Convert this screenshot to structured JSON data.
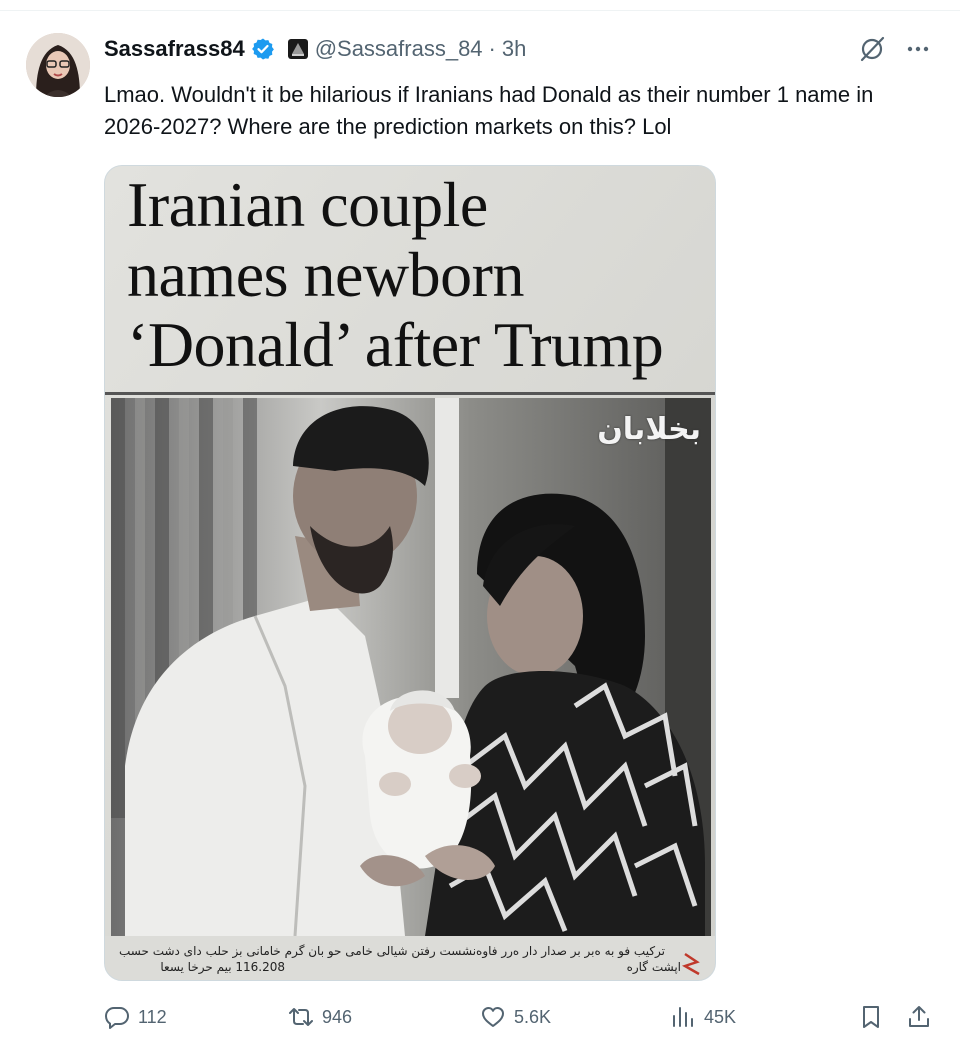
{
  "tweet": {
    "display_name": "Sassafrass84",
    "handle": "@Sassafrass_84",
    "separator": "·",
    "time": "3h",
    "text": "Lmao. Wouldn't it be hilarious if Iranians had Donald as their number 1 name in 2026-2027? Where are the prediction markets on this? Lol"
  },
  "media": {
    "headline_line1": "Iranian couple",
    "headline_line2": "names newborn",
    "headline_line3": "‘Donald’ after Trump",
    "watermark": "بخلابان",
    "caption_line1": "ترکیب فو به ه‌بر بر صدار دار ه‌رر فاوه‌نشست رفتن شیالی خامی حو بان گرم خامانی بز حلب دای دشت حسب",
    "caption_line2": "116.208 بیم حرخا یسعا",
    "caption_source": "اپشت گاره"
  },
  "actions": {
    "reply_count": "112",
    "repost_count": "946",
    "like_count": "5.6K",
    "views_count": "45K"
  },
  "icons": {
    "verified": "verified-badge-icon",
    "affiliate": "affiliate-badge-icon",
    "grok": "grok-icon",
    "more": "more-icon",
    "reply": "reply-icon",
    "repost": "repost-icon",
    "like": "heart-icon",
    "views": "views-icon",
    "bookmark": "bookmark-icon",
    "share": "share-icon"
  },
  "colors": {
    "text_primary": "#0f1419",
    "text_secondary": "#536471",
    "verified_blue": "#1d9bf0",
    "border": "#eff3f4"
  }
}
